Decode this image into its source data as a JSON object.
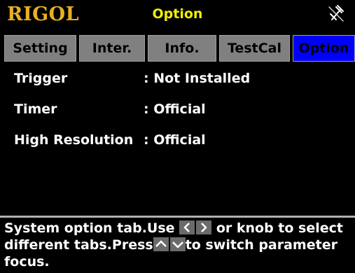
{
  "header": {
    "logo": "RIGOL",
    "title": "Option",
    "status_icon": "usb-disconnected-icon"
  },
  "tabs": [
    {
      "label": "Setting",
      "active": false
    },
    {
      "label": "Inter.",
      "active": false
    },
    {
      "label": "Info.",
      "active": false
    },
    {
      "label": "TestCal",
      "active": false
    },
    {
      "label": "Option",
      "active": true
    }
  ],
  "options": [
    {
      "name": "Trigger",
      "value": ": Not Installed"
    },
    {
      "name": "Timer",
      "value": ": Official"
    },
    {
      "name": "High Resolution",
      "value": ": Official"
    }
  ],
  "help": {
    "part1": "System option tab.Use",
    "part2": "or knob to select different tabs.Press",
    "part3": "to switch parameter focus.",
    "keys1": [
      "left-arrow-key-icon",
      "right-arrow-key-icon"
    ],
    "keys2": [
      "up-arrow-key-icon",
      "down-arrow-key-icon"
    ]
  },
  "colors": {
    "logo": "#e8b020",
    "title": "#f0f000",
    "tab_inactive": "#808080",
    "tab_active": "#0000ff"
  }
}
